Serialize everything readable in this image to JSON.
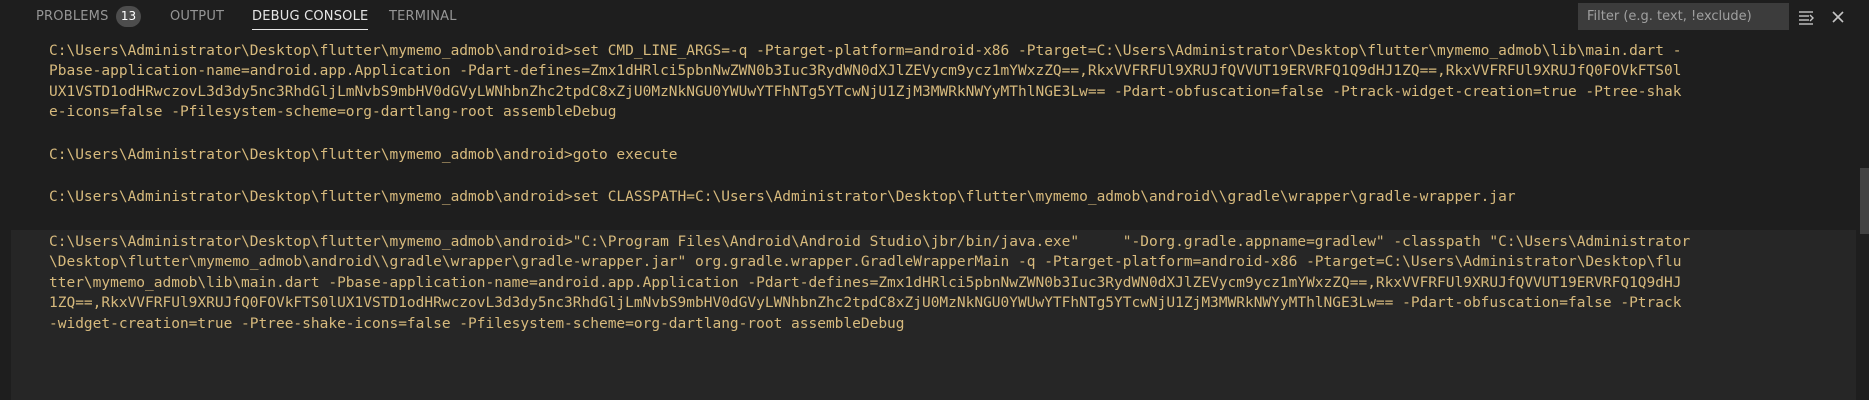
{
  "tabs": [
    {
      "label": "PROBLEMS",
      "badge": "13",
      "active": false
    },
    {
      "label": "OUTPUT",
      "active": false
    },
    {
      "label": "DEBUG CONSOLE",
      "active": true
    },
    {
      "label": "TERMINAL",
      "active": false
    }
  ],
  "filter": {
    "placeholder": "Filter (e.g. text, !exclude)"
  },
  "icons": [
    "collapse-all-icon",
    "close-icon"
  ],
  "colors": {
    "background": "#1e1e1e",
    "text": "#d7ba7d",
    "highlight": "#262626"
  },
  "console": {
    "groups": [
      {
        "lines": [
          "C:\\Users\\Administrator\\Desktop\\flutter\\mymemo_admob\\android>set CMD_LINE_ARGS=-q -Ptarget-platform=android-x86 -Ptarget=C:\\Users\\Administrator\\Desktop\\flutter\\mymemo_admob\\lib\\main.dart -",
          "Pbase-application-name=android.app.Application -Pdart-defines=Zmx1dHRlci5pbnNwZWN0b3Iuc3RydWN0dXJlZEVycm9ycz1mYWxzZQ==,RkxVVFRFUl9XRUJfQVVUT19ERVRFQ1Q9dHJ1ZQ==,RkxVVFRFUl9XRUJfQ0FOVkFTS0l",
          "UX1VSTD1odHRwczovL3d3dy5nc3RhdGljLmNvbS9mbHV0dGVyLWNhbnZhc2tpdC8xZjU0MzNkNGU0YWUwYTFhNTg5YTcwNjU1ZjM3MWRkNWYyMThlNGE3Lw== -Pdart-obfuscation=false -Ptrack-widget-creation=true -Ptree-shak",
          "e-icons=false -Pfilesystem-scheme=org-dartlang-root assembleDebug"
        ]
      },
      {
        "lines": [
          "C:\\Users\\Administrator\\Desktop\\flutter\\mymemo_admob\\android>goto execute"
        ]
      },
      {
        "lines": [
          "C:\\Users\\Administrator\\Desktop\\flutter\\mymemo_admob\\android>set CLASSPATH=C:\\Users\\Administrator\\Desktop\\flutter\\mymemo_admob\\android\\\\gradle\\wrapper\\gradle-wrapper.jar"
        ]
      },
      {
        "lines": [
          "C:\\Users\\Administrator\\Desktop\\flutter\\mymemo_admob\\android>\"C:\\Program Files\\Android\\Android Studio\\jbr/bin/java.exe\"     \"-Dorg.gradle.appname=gradlew\" -classpath \"C:\\Users\\Administrator",
          "\\Desktop\\flutter\\mymemo_admob\\android\\\\gradle\\wrapper\\gradle-wrapper.jar\" org.gradle.wrapper.GradleWrapperMain -q -Ptarget-platform=android-x86 -Ptarget=C:\\Users\\Administrator\\Desktop\\flu",
          "tter\\mymemo_admob\\lib\\main.dart -Pbase-application-name=android.app.Application -Pdart-defines=Zmx1dHRlci5pbnNwZWN0b3Iuc3RydWN0dXJlZEVycm9ycz1mYWxzZQ==,RkxVVFRFUl9XRUJfQVVUT19ERVRFQ1Q9dHJ",
          "1ZQ==,RkxVVFRFUl9XRUJfQ0FOVkFTS0lUX1VSTD1odHRwczovL3d3dy5nc3RhdGljLmNvbS9mbHV0dGVyLWNhbnZhc2tpdC8xZjU0MzNkNGU0YWUwYTFhNTg5YTcwNjU1ZjM3MWRkNWYyMThlNGE3Lw== -Pdart-obfuscation=false -Ptrack",
          "-widget-creation=true -Ptree-shake-icons=false -Pfilesystem-scheme=org-dartlang-root assembleDebug"
        ]
      }
    ]
  }
}
